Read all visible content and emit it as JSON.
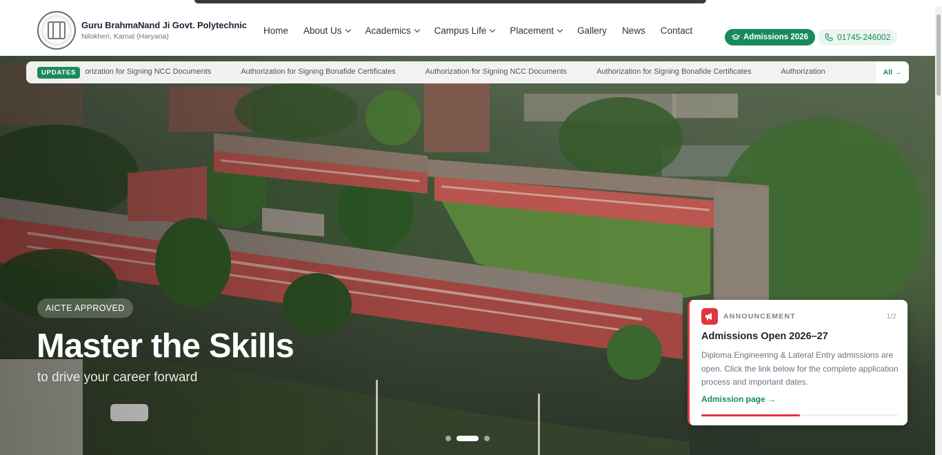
{
  "header": {
    "college_name": "Guru BrahmaNand Ji Govt. Polytechnic",
    "college_location": "Nilokheri, Karnal (Haryana)",
    "nav": [
      {
        "label": "Home",
        "dropdown": false
      },
      {
        "label": "About Us",
        "dropdown": true
      },
      {
        "label": "Academics",
        "dropdown": true
      },
      {
        "label": "Campus Life",
        "dropdown": true
      },
      {
        "label": "Placement",
        "dropdown": true
      },
      {
        "label": "Gallery",
        "dropdown": false
      },
      {
        "label": "News",
        "dropdown": false
      },
      {
        "label": "Contact",
        "dropdown": false
      }
    ],
    "admissions_button": "Admissions 2026",
    "phone": "01745-246002"
  },
  "ticker": {
    "tag": "UPDATES",
    "messages": [
      "horization for Signing NCC Documents",
      "Authorization for Signing Bonafide Certificates",
      "Authorization for Signing NCC Documents",
      "Authorization for Signing Bonafide Certificates",
      "Authorization"
    ],
    "all_link": "All →"
  },
  "hero": {
    "badge": "AICTE APPROVED",
    "title": "Master the Skills",
    "subtitle": "to drive your career forward",
    "slides_total": 3,
    "active_slide": 2
  },
  "announcement": {
    "kicker": "ANNOUNCEMENT",
    "counter": "1/2",
    "title": "Admissions Open 2026–27",
    "body": "Diploma Engineering & Lateral Entry admissions are open. Click the link below for the complete application process and important dates.",
    "link": "Admission page →",
    "progress": 0.5
  },
  "colors": {
    "accent_green": "#1a8a5a",
    "announcement_red": "#e3343f"
  }
}
